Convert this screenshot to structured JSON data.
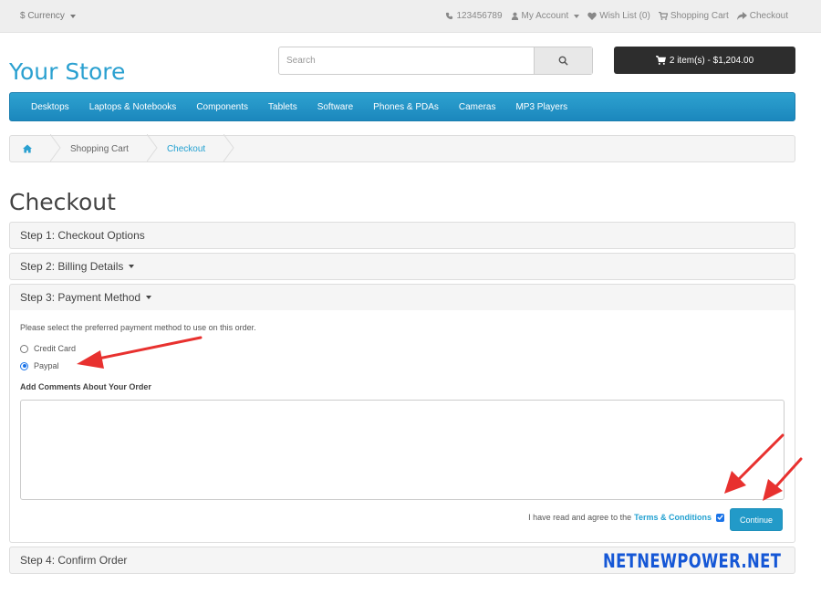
{
  "topbar": {
    "currency_label": "$ Currency",
    "phone": "123456789",
    "my_account": "My Account",
    "wish_list": "Wish List (0)",
    "shopping_cart": "Shopping Cart",
    "checkout": "Checkout"
  },
  "header": {
    "store_name": "Your Store",
    "search_placeholder": "Search",
    "cart_summary": "2 item(s) - $1,204.00"
  },
  "nav": {
    "items": [
      "Desktops",
      "Laptops & Notebooks",
      "Components",
      "Tablets",
      "Software",
      "Phones & PDAs",
      "Cameras",
      "MP3 Players"
    ]
  },
  "breadcrumb": {
    "items": [
      "Shopping Cart",
      "Checkout"
    ]
  },
  "page": {
    "title": "Checkout"
  },
  "steps": [
    {
      "label": "Step 1: Checkout Options"
    },
    {
      "label": "Step 2: Billing Details"
    },
    {
      "label": "Step 3: Payment Method"
    },
    {
      "label": "Step 4: Confirm Order"
    }
  ],
  "payment": {
    "instructions": "Please select the preferred payment method to use on this order.",
    "methods": [
      {
        "label": "Credit Card",
        "selected": false
      },
      {
        "label": "Paypal",
        "selected": true
      }
    ],
    "comments_label": "Add Comments About Your Order",
    "comments_value": "",
    "terms_text": "I have read and agree to the",
    "terms_link": "Terms & Conditions",
    "terms_checked": true,
    "continue_label": "Continue"
  },
  "watermark": "NETNEWPOWER.NET",
  "colors": {
    "accent": "#229ac8",
    "nav": "#1b87bd",
    "annotation": "#e8312f",
    "watermark": "#1557d6"
  }
}
